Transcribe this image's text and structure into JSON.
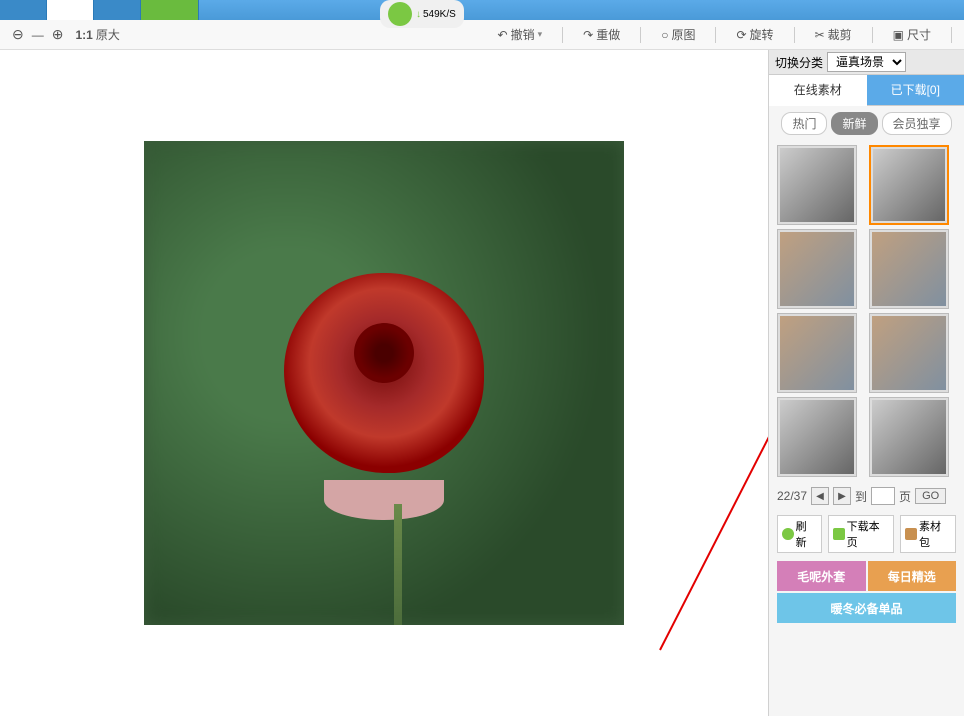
{
  "topBar": {
    "speed": "549K/S"
  },
  "toolbar": {
    "zoom_ratio": "1:1",
    "zoom_label": "原大",
    "undo": "撤销",
    "redo": "重做",
    "original": "原图",
    "rotate": "旋转",
    "crop": "裁剪",
    "size": "尺寸"
  },
  "sidePanel": {
    "switch_category_label": "切换分类",
    "category_value": "逼真场景",
    "tabs": {
      "online": "在线素材",
      "downloaded": "已下载[0]"
    },
    "filters": {
      "hot": "热门",
      "fresh": "新鲜",
      "vip": "会员独享"
    },
    "pagination": {
      "current": "22/37",
      "to_label": "到",
      "page_label": "页",
      "go": "GO"
    },
    "actions": {
      "refresh": "刷新",
      "download_page": "下载本页",
      "material_pack": "素材包"
    },
    "promos": {
      "p1": "毛呢外套",
      "p2": "每日精选",
      "p3": "暖冬必备单品"
    }
  }
}
